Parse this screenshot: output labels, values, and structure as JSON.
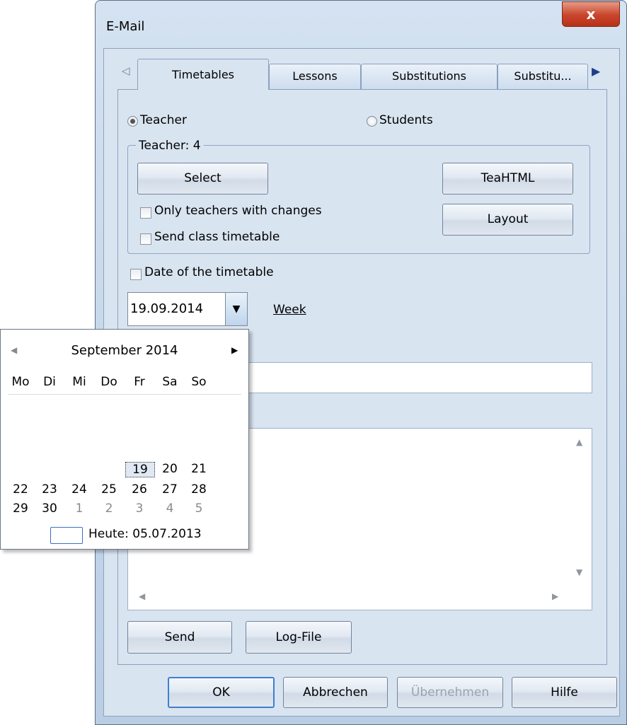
{
  "window": {
    "title": "E-Mail",
    "close_glyph": "x"
  },
  "tabs": {
    "scroll_left_glyph": "◁",
    "scroll_right_glyph": "▶",
    "items": [
      {
        "label": "Timetables",
        "active": true
      },
      {
        "label": "Lessons",
        "active": false
      },
      {
        "label": "Substitutions",
        "active": false
      },
      {
        "label": "Substitu...",
        "active": false
      }
    ]
  },
  "recipient": {
    "teacher_label": "Teacher",
    "students_label": "Students",
    "selected": "Teacher"
  },
  "teacher_group": {
    "legend": "Teacher: 4",
    "select_button": "Select",
    "teahtml_button": "TeaHTML",
    "layout_button": "Layout",
    "only_changes_label": "Only teachers with changes",
    "only_changes_checked": false,
    "send_class_label": "Send class timetable",
    "send_class_checked": false
  },
  "timetable_date": {
    "checkbox_label": "Date of the timetable",
    "checked": false,
    "value": "19.09.2014",
    "week_link": "Week"
  },
  "calendar": {
    "month_title": "September 2014",
    "prev_glyph": "◀",
    "next_glyph": "▶",
    "weekdays": [
      "Mo",
      "Di",
      "Mi",
      "Do",
      "Fr",
      "Sa",
      "So"
    ],
    "weeks": [
      [
        [
          "19",
          "selected"
        ],
        [
          "20",
          "normal"
        ],
        [
          "21",
          "normal"
        ]
      ],
      [
        [
          "22",
          "normal"
        ],
        [
          "23",
          "normal"
        ],
        [
          "24",
          "normal"
        ],
        [
          "25",
          "normal"
        ],
        [
          "26",
          "normal"
        ],
        [
          "27",
          "normal"
        ],
        [
          "28",
          "normal"
        ]
      ],
      [
        [
          "29",
          "normal"
        ],
        [
          "30",
          "normal"
        ],
        [
          "1",
          "muted"
        ],
        [
          "2",
          "muted"
        ],
        [
          "3",
          "muted"
        ],
        [
          "4",
          "muted"
        ],
        [
          "5",
          "muted"
        ]
      ]
    ],
    "today_label": "Heute: 05.07.2013"
  },
  "actions": {
    "send_button": "Send",
    "logfile_button": "Log-File"
  },
  "dialog_buttons": {
    "ok": "OK",
    "cancel": "Abbrechen",
    "apply": "Übernehmen",
    "help": "Hilfe"
  },
  "scroll_glyphs": {
    "up": "▲",
    "down": "▼",
    "left": "◀",
    "right": "▶"
  },
  "colors": {
    "accent": "#3f7fcf",
    "frame": "#b9cde4",
    "close": "#c8442b"
  }
}
